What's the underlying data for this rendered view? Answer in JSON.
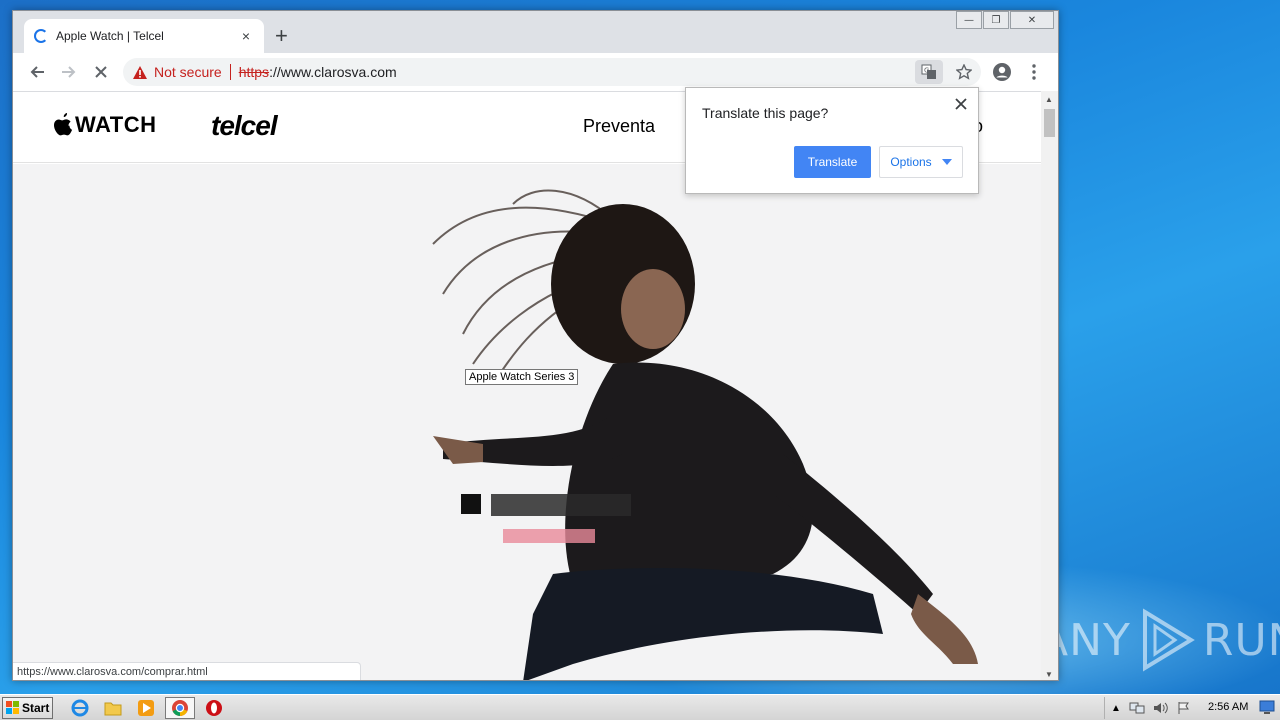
{
  "browser": {
    "tab_title": "Apple Watch | Telcel",
    "new_tab_symbol": "+",
    "tab_close_symbol": "×",
    "security_label": "Not secure",
    "url_scheme": "https",
    "url_rest": "://www.clarosva.com",
    "status_url": "https://www.clarosva.com/comprar.html",
    "window_controls": {
      "minimize": "—",
      "restore": "❐",
      "close": "✕"
    }
  },
  "site": {
    "brand_watch": "WATCH",
    "brand_telcel": "telcel",
    "nav_preventa": "Preventa",
    "nav_partial": "o",
    "hero_tooltip": "Apple Watch Series 3"
  },
  "translate_popup": {
    "title": "Translate this page?",
    "translate_label": "Translate",
    "options_label": "Options"
  },
  "taskbar": {
    "start_label": "Start",
    "clock": "2:56 AM"
  },
  "watermark": {
    "text_left": "ANY",
    "text_right": "RUN"
  },
  "colors": {
    "accent_blue": "#4285f4",
    "not_secure_red": "#c5221f",
    "desktop_blue": "#1a86dd"
  }
}
